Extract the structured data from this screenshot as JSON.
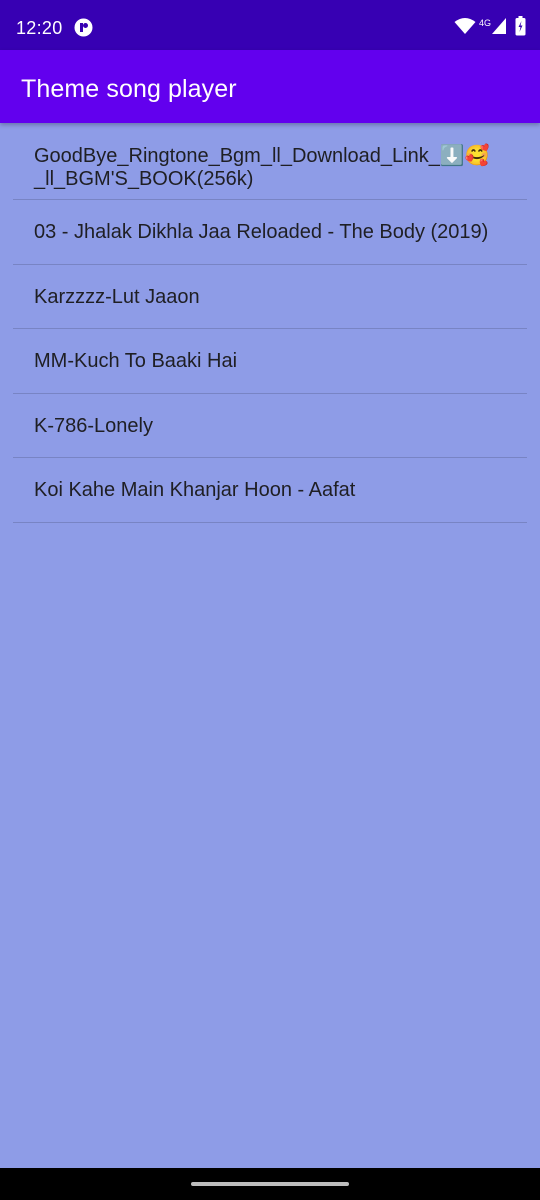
{
  "status_bar": {
    "time": "12:20",
    "network": "4G",
    "app_icon": "app-notification-icon",
    "icons": [
      "wifi-icon",
      "cell-signal-icon",
      "battery-icon"
    ]
  },
  "app_bar": {
    "title": "Theme song player"
  },
  "songs": [
    {
      "title": "GoodBye_Ringtone_Bgm_ll_Download_Link_⬇️🥰\n_ll_BGM'S_BOOK(256k)"
    },
    {
      "title": "03 - Jhalak Dikhla Jaa Reloaded - The Body (2019)"
    },
    {
      "title": "Karzzzz-Lut Jaaon"
    },
    {
      "title": "MM-Kuch To Baaki Hai"
    },
    {
      "title": "K-786-Lonely"
    },
    {
      "title": "Koi Kahe Main Khanjar Hoon - Aafat"
    }
  ],
  "colors": {
    "status_bar": "#3700b3",
    "app_bar": "#6200ee",
    "background": "#8e9ce7",
    "divider": "#7884c4",
    "text": "#1f1f24"
  }
}
